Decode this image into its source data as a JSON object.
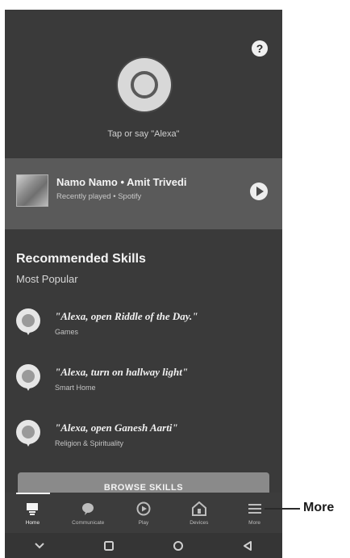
{
  "header": {
    "help_label": "?",
    "prompt_text": "Tap or say \"Alexa\""
  },
  "now_playing": {
    "title": "Namo Namo • Amit Trivedi",
    "subtitle": "Recently played • Spotify",
    "play_icon": "play-icon"
  },
  "skills_section": {
    "title": "Recommended Skills",
    "subtitle": "Most Popular",
    "items": [
      {
        "quote": "\"Alexa, open Riddle of the Day.\"",
        "category": "Games",
        "icon": "speech-bubble-icon"
      },
      {
        "quote": "\"Alexa, turn on hallway light\"",
        "category": "Smart Home",
        "icon": "speech-bubble-icon"
      },
      {
        "quote": "\"Alexa, open Ganesh Aarti\"",
        "category": "Religion & Spirituality",
        "icon": "speech-bubble-icon"
      }
    ],
    "browse_label": "BROWSE SKILLS"
  },
  "tabbar": {
    "tabs": [
      {
        "label": "Home",
        "icon": "home-icon",
        "active": true
      },
      {
        "label": "Communicate",
        "icon": "chat-icon",
        "active": false
      },
      {
        "label": "Play",
        "icon": "play-icon",
        "active": false
      },
      {
        "label": "Devices",
        "icon": "devices-icon",
        "active": false
      },
      {
        "label": "More",
        "icon": "menu-icon",
        "active": false
      }
    ]
  },
  "system_nav": {
    "buttons": [
      "collapse-icon",
      "recents-icon",
      "home-circle-icon",
      "back-icon"
    ]
  },
  "annotation": {
    "label": "More"
  },
  "colors": {
    "background": "#3a3a3a",
    "card": "#5a5a5a",
    "text_primary": "#f4f4f4"
  }
}
